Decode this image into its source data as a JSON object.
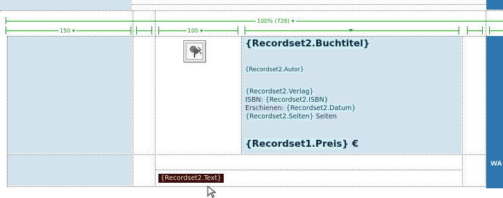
{
  "ruler": {
    "total_label": "100% (726)",
    "col1_label": "150",
    "col3_label": "100"
  },
  "content": {
    "title": "{Recordset2.Buchtitel}",
    "author": "{Recordset2.Autor}",
    "publisher": "{Recordset2.Verlag}",
    "isbn_label": "ISBN: ",
    "isbn": "{Recordset2.ISBN}",
    "published_label": "Erschienen: ",
    "published": "{Recordset2.Datum}",
    "pages": "{Recordset2.Seiten}",
    "pages_suffix": " Seiten",
    "price": "{Recordset1.Preis}",
    "currency": " €",
    "text_field": "{Recordset2.Text}",
    "right_label": "WA"
  },
  "colors": {
    "light_cell": "#d2e3ee",
    "right_column": "#2d76b0",
    "ruler": "#19a519",
    "placeholder_highlight": "#cfeff4",
    "selected_tag": "#3b0a0a"
  }
}
